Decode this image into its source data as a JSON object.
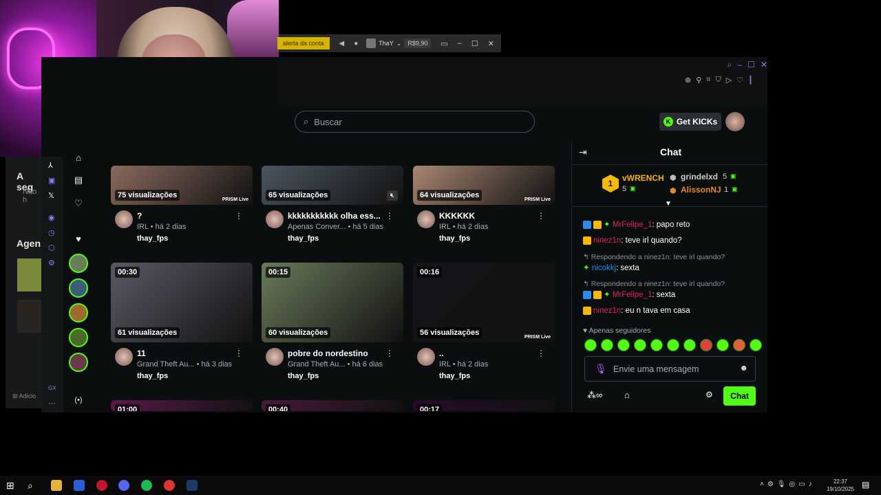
{
  "topbar": {
    "alert_label": "alerta da conta",
    "user_name": "ThaY",
    "balance": "R$9,90"
  },
  "search": {
    "placeholder": "Buscar"
  },
  "header": {
    "get_kicks": "Get KICKs"
  },
  "left_panel": {
    "heading1": "A seg",
    "sub1": "Não h",
    "heading2": "Agen",
    "add_label": "Adicio"
  },
  "videos": [
    {
      "views": "75 visualizações",
      "duration": "",
      "title": "?",
      "meta": "IRL • há 2 dias",
      "channel": "thay_fps"
    },
    {
      "views": "65 visualizações",
      "duration": "",
      "title": "kkkkkkkkkkk olha ess...",
      "meta": "Apenas Conver... • há 5 dias",
      "channel": "thay_fps"
    },
    {
      "views": "64 visualizações",
      "duration": "",
      "title": "KKKKKK",
      "meta": "IRL • há 2 dias",
      "channel": "thay_fps"
    },
    {
      "views": "61 visualizações",
      "duration": "00:30",
      "title": "11",
      "meta": "Grand Theft Au... • há 3 dias",
      "channel": "thay_fps"
    },
    {
      "views": "60 visualizações",
      "duration": "00:15",
      "title": "pobre do nordestino",
      "meta": "Grand Theft Au... • há 6 dias",
      "channel": "thay_fps"
    },
    {
      "views": "56 visualizações",
      "duration": "00:16",
      "title": "..",
      "meta": "IRL • há 2 dias",
      "channel": "thay_fps"
    },
    {
      "views": "",
      "duration": "01:00",
      "title": "",
      "meta": "",
      "channel": ""
    },
    {
      "views": "",
      "duration": "00:40",
      "title": "",
      "meta": "",
      "channel": ""
    },
    {
      "views": "",
      "duration": "00:17",
      "title": "",
      "meta": "",
      "channel": ""
    }
  ],
  "prism_label": "PRISM Live",
  "chat": {
    "title": "Chat",
    "leaderboard": [
      {
        "rank": "1",
        "name": "vWRENCH",
        "count": "5"
      },
      {
        "rank": "2",
        "name": "grindelxd",
        "count": "5"
      },
      {
        "rank": "3",
        "name": "AlissonNJ",
        "count": "1"
      }
    ],
    "messages": [
      {
        "user": "MrFelipe_1",
        "text": ": papo reto",
        "reply": ""
      },
      {
        "user": "ninez1n",
        "text": ": teve irl quando?",
        "reply": ""
      },
      {
        "user": "nicokkj",
        "text": ": sexta",
        "reply": "Respondendo a ninez1n: teve irl quando?"
      },
      {
        "user": "MrFelipe_1",
        "text": ": sexta",
        "reply": "Respondendo a ninez1n: teve irl quando?"
      },
      {
        "user": "ninez1n",
        "text": ": eu n tava em casa",
        "reply": ""
      }
    ],
    "followers_only": "Apenas seguidores",
    "input_placeholder": "Envie uma mensagem",
    "send_label": "Chat"
  },
  "taskbar": {
    "time": "22:37",
    "date": "19/10/2025"
  },
  "colors": {
    "accent": "#53fc18",
    "purple": "#8b7cf6"
  }
}
